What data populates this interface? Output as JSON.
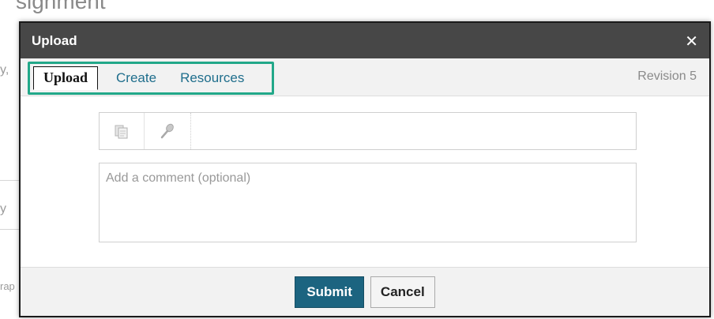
{
  "background": {
    "title_fragment": "signment",
    "fragments": [
      "y,",
      "y",
      "rap"
    ]
  },
  "modal": {
    "title": "Upload",
    "close_symbol": "✕"
  },
  "tabs": [
    {
      "label": "Upload",
      "active": true
    },
    {
      "label": "Create",
      "active": false
    },
    {
      "label": "Resources",
      "active": false
    }
  ],
  "revision": "Revision 5",
  "toolbar": {
    "icons": [
      "attach-file-icon",
      "microphone-icon"
    ]
  },
  "comment": {
    "placeholder": "Add a comment (optional)",
    "value": ""
  },
  "footer": {
    "submit_label": "Submit",
    "cancel_label": "Cancel"
  },
  "colors": {
    "header": "#474747",
    "tab_highlight": "#22a889",
    "submit": "#1c6480",
    "link": "#1f6e8c"
  }
}
